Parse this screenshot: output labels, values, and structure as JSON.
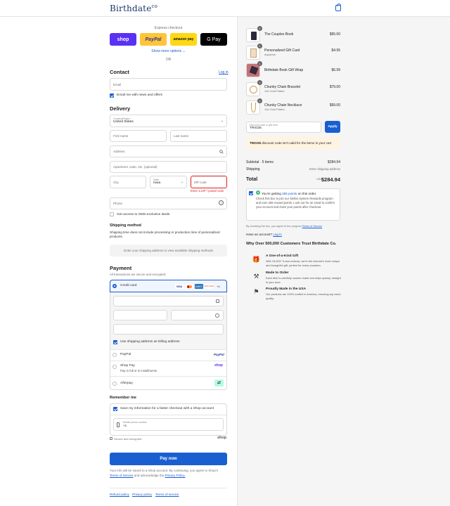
{
  "brand": {
    "name": "Birthdate",
    "suffix": "co"
  },
  "express": {
    "label": "Express checkout",
    "buttons": [
      "shop",
      "PayPal",
      "amazon pay",
      "G Pay"
    ],
    "show_more": "Show more options ⌄",
    "or": "OR"
  },
  "contact": {
    "title": "Contact",
    "login": "Log in",
    "email_placeholder": "Email",
    "news_label": "Email me with news and offers"
  },
  "delivery": {
    "title": "Delivery",
    "country_label": "Country/Region",
    "country": "United States",
    "first_name": "First name",
    "last_name": "Last name",
    "address": "Address",
    "apartment": "Apartment, suite, etc. (optional)",
    "city": "City",
    "state_label": "State",
    "state": "Iowa",
    "zip": "ZIP code",
    "zip_error": "Enter a ZIP / postal code",
    "phone": "Phone",
    "sms_label": "Get access to SMS-exclusive deals"
  },
  "shipping": {
    "title": "Shipping method",
    "note": "Shipping time does not include processing or production time of personalized products.",
    "placeholder": "Enter your shipping address to view available shipping methods"
  },
  "payment": {
    "title": "Payment",
    "subtitle": "All transactions are secure and encrypted.",
    "credit_card": "Credit card",
    "card_logos": [
      "VISA",
      "MC",
      "AMEX",
      "DISCOVER"
    ],
    "more_cards": "+4",
    "billing_same": "Use shipping address as billing address",
    "paypal": "PayPal",
    "paypal_logo": "PayPal",
    "shop_pay": "Shop Pay",
    "shop_pay_sub": "Pay in full or in installments",
    "shop_logo": "shop",
    "afterpay": "Afterpay"
  },
  "remember": {
    "title": "Remember me",
    "save_label": "Save my information for a faster checkout with a Shop account",
    "phone_label": "Mobile phone number",
    "phone_value": "+1",
    "secure": "Secure and encrypted",
    "shop": "shop"
  },
  "pay_now": "Pay now",
  "legal": {
    "text1": "Your info will be saved to a Shop account. By continuing, you agree to Shop's",
    "tos": "Terms of Service",
    "and": "and acknowledge the",
    "privacy": "Privacy Policy."
  },
  "footer_links": [
    "Refund policy",
    "Privacy policy",
    "Terms of service"
  ],
  "cart": {
    "items": [
      {
        "name": "The Couples Book",
        "sub": "",
        "price": "$95.00",
        "qty": "1"
      },
      {
        "name": "Personalized Gift Card",
        "sub": "Aquarius",
        "price": "$4.95",
        "qty": "1"
      },
      {
        "name": "Birthdate Book Gift Wrap",
        "sub": "",
        "price": "$6.99",
        "qty": "1"
      },
      {
        "name": "Chunky Chain Bracelet",
        "sub": "14k Gold Plated",
        "price": "$79.00",
        "qty": "1"
      },
      {
        "name": "Chunky Chain Necklace",
        "sub": "14k Gold Plated",
        "price": "$99.00",
        "qty": "1"
      }
    ],
    "discount_label": "Discount code or gift card",
    "discount_value": "TRIO25",
    "apply": "Apply",
    "discount_error_code": "TRIO25",
    "discount_error": "discount code isn't valid for the items in your cart",
    "subtotal_label": "Subtotal · 5 items",
    "subtotal": "$284.94",
    "shipping_label": "Shipping",
    "shipping_value": "Enter shipping address",
    "total_label": "Total",
    "currency": "USD",
    "total": "$284.94"
  },
  "rewards": {
    "headline_pre": "You're getting",
    "points": "285 points",
    "headline_post": "on this order.",
    "body": "Check this box to join our Stellar System Rewards program and earn 285 reward points. Look out for an email to confirm your account and claim your points after checkout.",
    "disclaimer": "By checking the box, you agree to the program",
    "disclaimer_link": "Terms of Service"
  },
  "account": {
    "text": "Have an account?",
    "link": "Log in"
  },
  "why": {
    "title": "Why Over 500,000 Customers Trust Birthdate Co.",
    "features": [
      {
        "icon": "gift-icon",
        "title": "A One-of-a-Kind Gift",
        "body": "With 15,000+ 5-star reviews, we're the internet's most unique and thoughtful gift, perfect for every occasion."
      },
      {
        "icon": "hammer-icon",
        "title": "Made to Order",
        "body": "Each item is carefully custom-made and ships quickly, straight to your door."
      },
      {
        "icon": "flag-icon",
        "title": "Proudly Made in the USA",
        "body": "Our products are 100% crafted in America, ensuring top notch quality."
      }
    ]
  },
  "colors": {
    "accent": "#1a5fd0",
    "error": "#dd1d1d",
    "shop": "#5a31f4"
  }
}
